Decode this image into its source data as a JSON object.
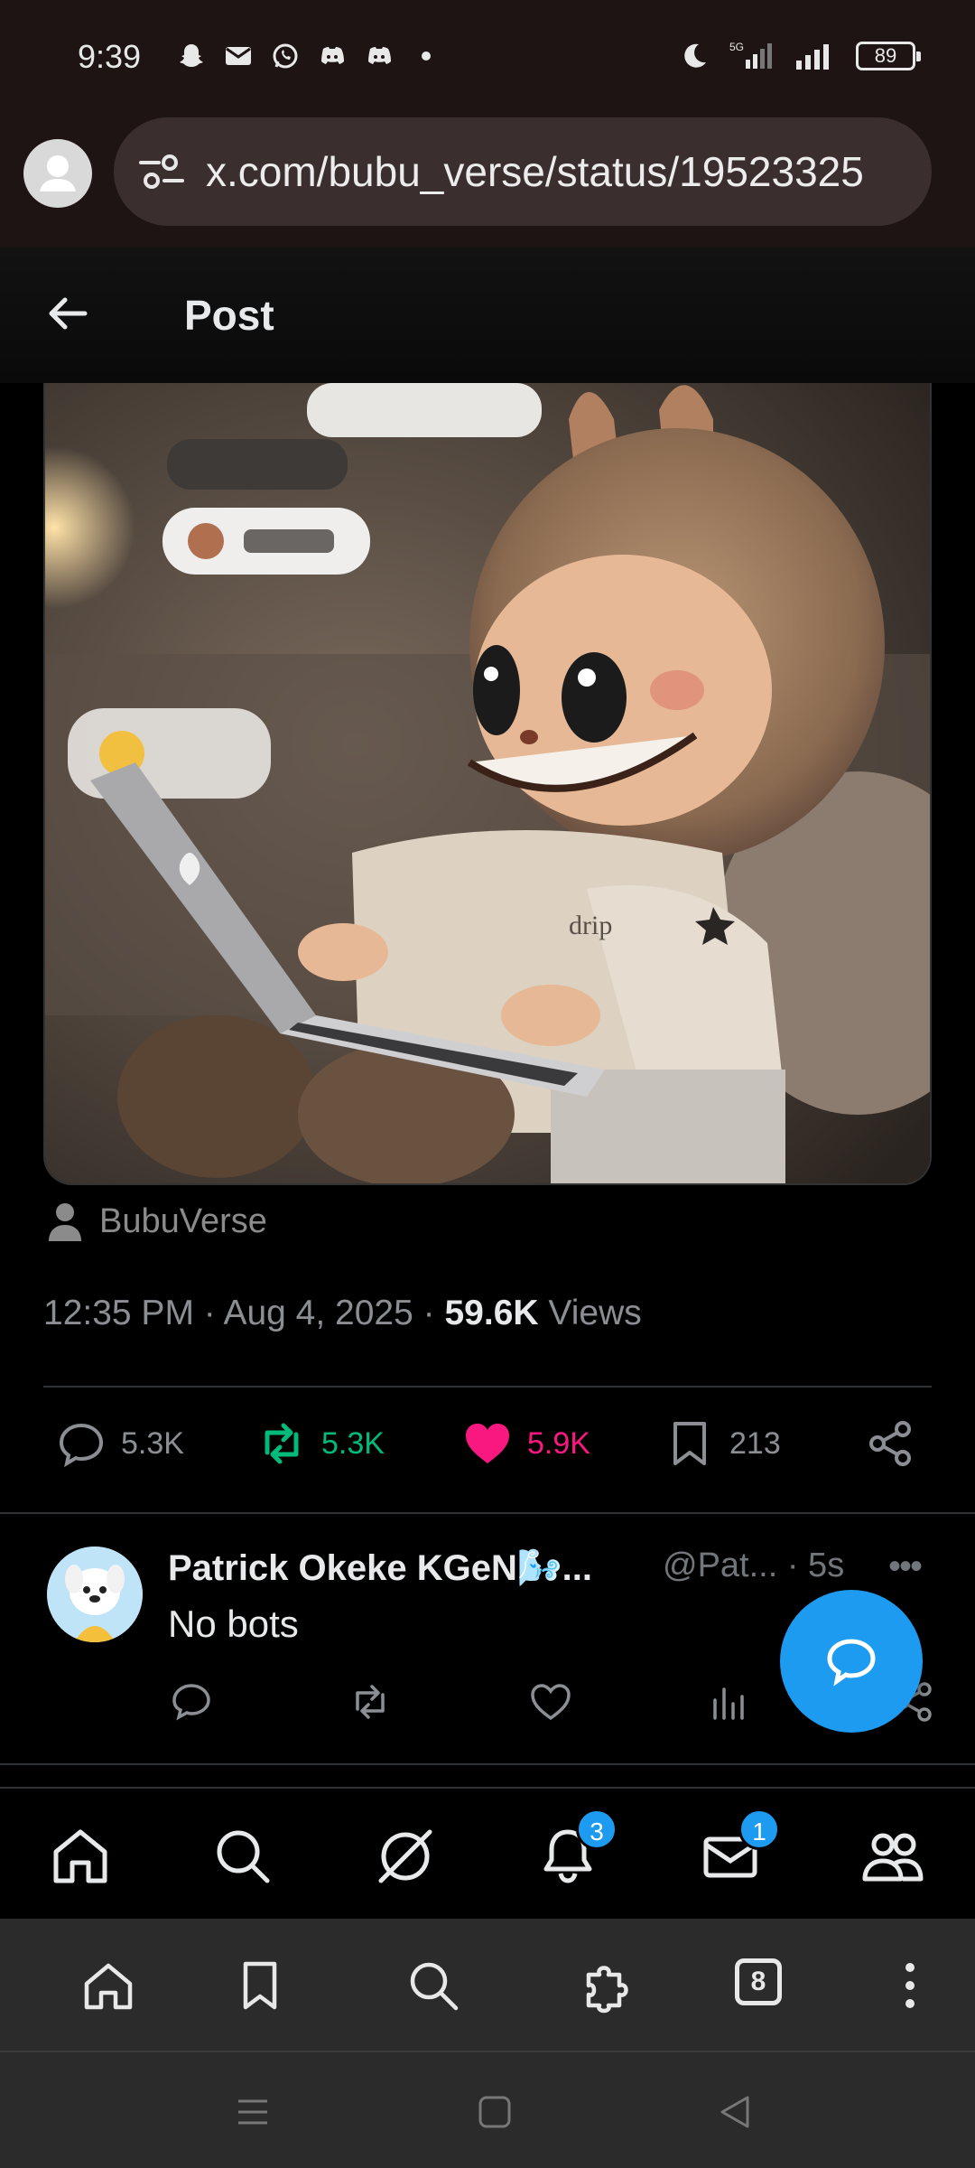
{
  "status_bar": {
    "time": "9:39",
    "network": "5G",
    "battery": "89",
    "app_icons": [
      "snapchat-icon",
      "gmail-icon",
      "whatsapp-icon",
      "discord-icon",
      "discord-icon",
      "dot-icon"
    ]
  },
  "url_bar": {
    "url": "x.com/bubu_verse/status/19523325"
  },
  "header": {
    "title": "Post"
  },
  "post": {
    "image_alt": "Labubu plush figure using a laptop",
    "author": "BubuVerse",
    "time": "12:35 PM",
    "date": "Aug 4, 2025",
    "views_count": "59.6K",
    "views_label": "Views",
    "replies": "5.3K",
    "reposts": "5.3K",
    "likes": "5.9K",
    "bookmarks": "213"
  },
  "reply": {
    "name": "Patrick Okeke KGeN🌬️...",
    "handle_time": "@Pat... · 5s",
    "more": "•••",
    "text": "No bots"
  },
  "bottom_nav": {
    "notifications_badge": "3",
    "messages_badge": "1"
  },
  "browser": {
    "tab_count": "8"
  },
  "colors": {
    "accent": "#1d9bf0",
    "repost": "#00ba7c",
    "like": "#f91880"
  }
}
